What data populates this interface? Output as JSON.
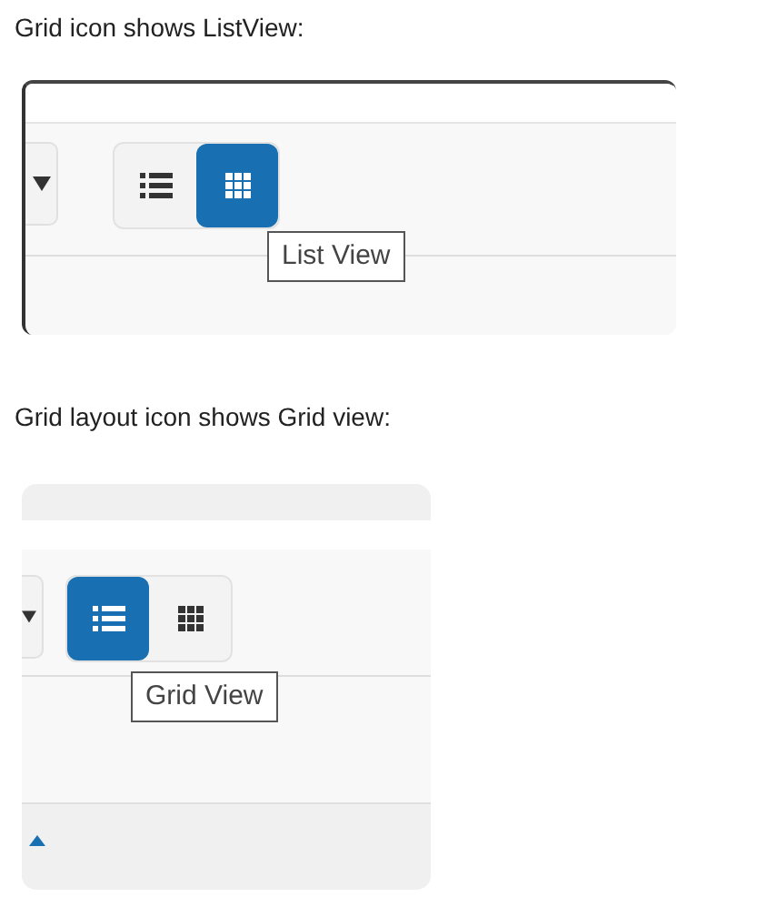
{
  "sections": [
    {
      "caption": "Grid icon shows ListView:",
      "screenshot": {
        "kind": "framed",
        "view_buttons": [
          {
            "kind": "list",
            "selected": false
          },
          {
            "kind": "grid",
            "selected": true
          }
        ],
        "tooltip": "List View"
      }
    },
    {
      "caption": "Grid layout icon shows Grid view:",
      "screenshot": {
        "kind": "cropped",
        "view_buttons": [
          {
            "kind": "list",
            "selected": true
          },
          {
            "kind": "grid",
            "selected": false
          }
        ],
        "tooltip": "Grid View"
      }
    }
  ]
}
